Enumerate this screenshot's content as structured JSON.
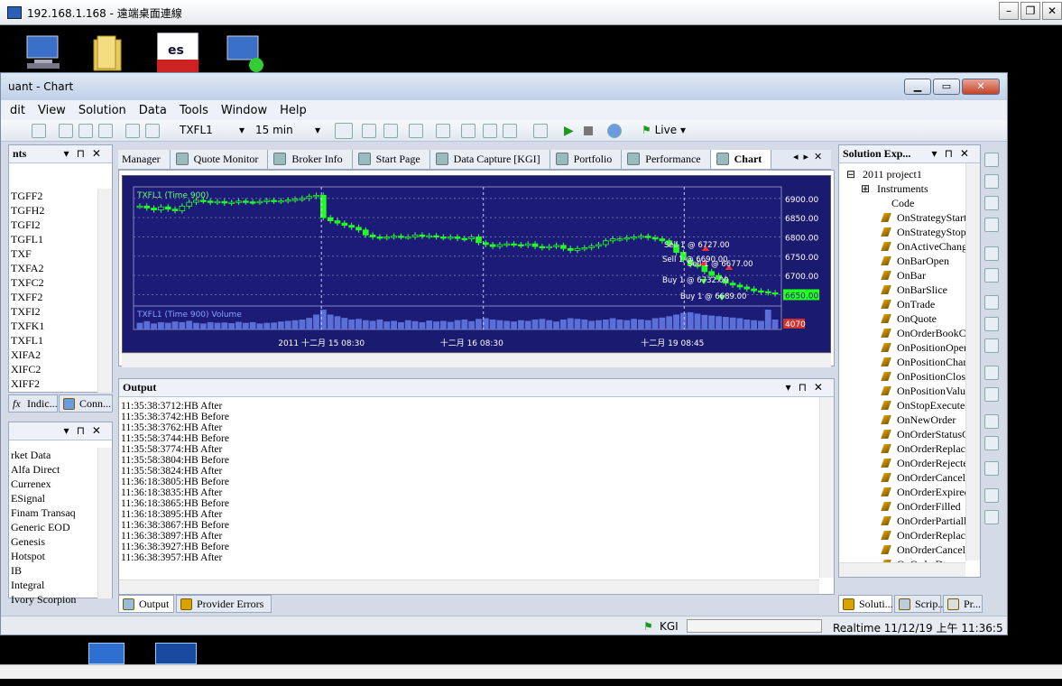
{
  "rdp": {
    "title": "192.168.1.168 - 遠端桌面連線",
    "min": "–",
    "restore": "❐",
    "close": "✕"
  },
  "app": {
    "title": "uant - Chart"
  },
  "menu": [
    "dit",
    "View",
    "Solution",
    "Data",
    "Tools",
    "Window",
    "Help"
  ],
  "toolbar": {
    "symbol": "TXFL1",
    "interval": "15 min",
    "mode": "Live"
  },
  "left_top": {
    "header": "nts",
    "items": [
      "TGFF2",
      "TGFH2",
      "TGFI2",
      "TGFL1",
      "TXF",
      "TXFA2",
      "TXFC2",
      "TXFF2",
      "TXFI2",
      "TXFK1",
      "TXFL1",
      "XIFA2",
      "XIFC2",
      "XIFF2"
    ]
  },
  "left_tabs": [
    "Indic...",
    "Conn..."
  ],
  "left_bottom": {
    "items": [
      "rket Data",
      "Alfa Direct",
      "Currenex",
      "ESignal",
      "Finam Transaq",
      "Generic EOD",
      "Genesis",
      "Hotspot",
      "IB",
      "Integral",
      "Ivory Scorpion"
    ]
  },
  "tabs": [
    "Manager",
    "Quote Monitor",
    "Broker Info",
    "Start Page",
    "Data Capture [KGI]",
    "Portfolio",
    "Performance",
    "Chart"
  ],
  "chart_data": {
    "type": "bar",
    "title": "TXFL1 (Time 900)",
    "volume_title": "TXFL1 (Time 900) Volume",
    "price_ticks": [
      "6900.00",
      "6850.00",
      "6800.00",
      "6750.00",
      "6700.00",
      "6650.00"
    ],
    "last_price": "6650.00",
    "volume_last": "4070",
    "x_labels": [
      "2011 十二月 15 08:30",
      "十二月 16 08:30",
      "十二月 19 08:45"
    ],
    "ylim": [
      6630,
      6930
    ],
    "closes": [
      6880,
      6875,
      6870,
      6878,
      6872,
      6868,
      6880,
      6890,
      6895,
      6893,
      6890,
      6892,
      6888,
      6890,
      6893,
      6891,
      6890,
      6892,
      6895,
      6893,
      6894,
      6896,
      6898,
      6900,
      6905,
      6908,
      6850,
      6842,
      6836,
      6830,
      6825,
      6818,
      6805,
      6800,
      6798,
      6800,
      6802,
      6800,
      6800,
      6805,
      6802,
      6803,
      6800,
      6798,
      6800,
      6796,
      6795,
      6800,
      6785,
      6780,
      6775,
      6780,
      6782,
      6780,
      6778,
      6782,
      6775,
      6772,
      6775,
      6778,
      6770,
      6765,
      6770,
      6772,
      6776,
      6780,
      6790,
      6795,
      6795,
      6798,
      6800,
      6802,
      6798,
      6795,
      6790,
      6780,
      6760,
      6740,
      6727,
      6725,
      6710,
      6700,
      6690,
      6680,
      6675,
      6670,
      6665,
      6660,
      6658,
      6655,
      6652
    ],
    "volumes": [
      20,
      25,
      18,
      22,
      20,
      24,
      22,
      26,
      20,
      18,
      22,
      20,
      21,
      19,
      23,
      20,
      22,
      18,
      20,
      21,
      24,
      26,
      28,
      30,
      35,
      45,
      60,
      45,
      40,
      35,
      30,
      32,
      28,
      26,
      30,
      24,
      26,
      22,
      28,
      25,
      22,
      27,
      24,
      26,
      23,
      28,
      30,
      25,
      32,
      34,
      30,
      28,
      26,
      24,
      28,
      26,
      30,
      32,
      28,
      24,
      30,
      34,
      32,
      30,
      26,
      28,
      30,
      34,
      30,
      28,
      32,
      30,
      28,
      34,
      36,
      40,
      45,
      50,
      52,
      48,
      44,
      42,
      40,
      38,
      36,
      34,
      30,
      28,
      26,
      60,
      30
    ],
    "trades": [
      {
        "label": "Sell 1 @ 6727.00"
      },
      {
        "label": "Sell 1 @ 6690.00"
      },
      {
        "label": "Sell 1 @ 6677.00"
      },
      {
        "label": "Buy 1 @ 6732.00"
      },
      {
        "label": "Buy 1 @ 6689.00"
      }
    ]
  },
  "output": {
    "header": "Output",
    "lines": [
      "11:35:38:3712:HB After",
      "11:35:38:3742:HB Before",
      "11:35:38:3762:HB After",
      "11:35:58:3744:HB Before",
      "11:35:58:3774:HB After",
      "11:35:58:3804:HB Before",
      "11:35:58:3824:HB After",
      "11:36:18:3805:HB Before",
      "11:36:18:3835:HB After",
      "11:36:18:3865:HB Before",
      "11:36:18:3895:HB After",
      "11:36:38:3867:HB Before",
      "11:36:38:3897:HB After",
      "11:36:38:3927:HB Before",
      "11:36:38:3957:HB After"
    ],
    "tabs": [
      "Output",
      "Provider Errors"
    ]
  },
  "solution": {
    "header": "Solution Exp...",
    "project": "2011 project1",
    "instruments": "Instruments",
    "code": "Code",
    "events": [
      "OnStrategyStart",
      "OnStrategyStop",
      "OnActiveChange",
      "OnBarOpen",
      "OnBar",
      "OnBarSlice",
      "OnTrade",
      "OnQuote",
      "OnOrderBookCh",
      "OnPositionOpen",
      "OnPositionChan",
      "OnPositionClose",
      "OnPositionValue",
      "OnStopExecuted",
      "OnNewOrder",
      "OnOrderStatusC",
      "OnOrderReplace",
      "OnOrderRejected",
      "OnOrderCancelle",
      "OnOrderExpired",
      "OnOrderFilled",
      "OnOrderPartially",
      "OnOrderReplace",
      "OnOrderCancelR",
      "OnOrderDone"
    ],
    "tabs": [
      "Soluti...",
      "Scrip...",
      "Pr..."
    ]
  },
  "status": {
    "provider": "KGI",
    "realtime": "Realtime 11/12/19 上午 11:36:5"
  }
}
